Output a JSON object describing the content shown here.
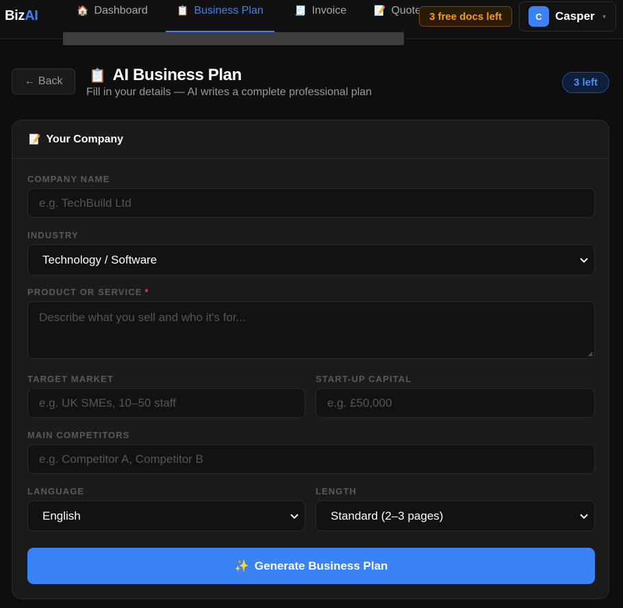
{
  "brand": {
    "name_part1": "Biz",
    "name_part2": "AI"
  },
  "nav": {
    "tabs": [
      {
        "icon": "🏠",
        "label": "Dashboard",
        "active": false
      },
      {
        "icon": "📋",
        "label": "Business Plan",
        "active": true
      },
      {
        "icon": "🧾",
        "label": "Invoice",
        "active": false
      },
      {
        "icon": "📝",
        "label": "Quote",
        "active": false
      }
    ]
  },
  "header": {
    "free_docs": "3 free docs left",
    "user": {
      "initial": "C",
      "name": "Casper"
    }
  },
  "page": {
    "back_label": "← Back",
    "title_icon": "📋",
    "title": "AI Business Plan",
    "subtitle": "Fill in your details — AI writes a complete professional plan",
    "remaining_badge": "3 left"
  },
  "form": {
    "section_icon": "📝",
    "section_title": "Your Company",
    "company_name": {
      "label": "COMPANY NAME",
      "value": "",
      "placeholder": "e.g. TechBuild Ltd"
    },
    "industry": {
      "label": "INDUSTRY",
      "selected": "Technology / Software"
    },
    "product": {
      "label": "PRODUCT OR SERVICE",
      "required_mark": "*",
      "value": "",
      "placeholder": "Describe what you sell and who it's for..."
    },
    "target_market": {
      "label": "TARGET MARKET",
      "value": "",
      "placeholder": "e.g. UK SMEs, 10–50 staff"
    },
    "startup_capital": {
      "label": "START-UP CAPITAL",
      "value": "",
      "placeholder": "e.g. £50,000"
    },
    "competitors": {
      "label": "MAIN COMPETITORS",
      "value": "",
      "placeholder": "e.g. Competitor A, Competitor B"
    },
    "language": {
      "label": "LANGUAGE",
      "selected": "English"
    },
    "length": {
      "label": "LENGTH",
      "selected": "Standard (2–3 pages)"
    },
    "submit_icon": "✨",
    "submit_label": "Generate Business Plan"
  },
  "colors": {
    "accent": "#3b82f6",
    "warning": "#f59e0b",
    "required": "#ef4444",
    "background": "#0e0e0e",
    "card": "#1b1b1b"
  }
}
